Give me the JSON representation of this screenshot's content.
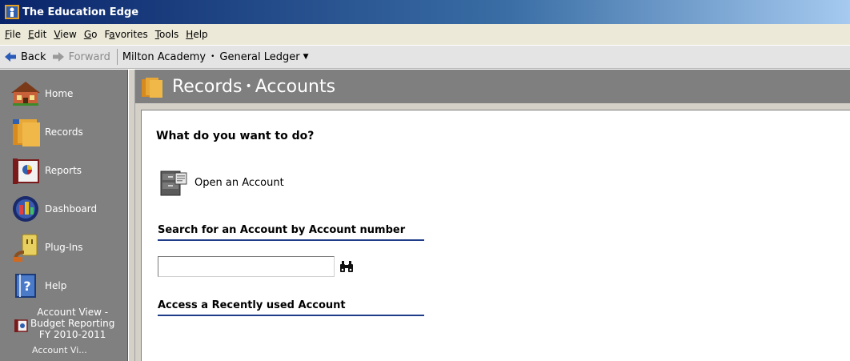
{
  "window": {
    "title": "The Education Edge"
  },
  "menu": [
    {
      "label": "File",
      "underline": "F",
      "rest": "ile"
    },
    {
      "label": "Edit",
      "underline": "E",
      "rest": "dit"
    },
    {
      "label": "View",
      "underline": "V",
      "rest": "iew"
    },
    {
      "label": "Go",
      "underline": "G",
      "rest": "o"
    },
    {
      "label": "Favorites",
      "pre": "F",
      "underline": "a",
      "rest": "vorites"
    },
    {
      "label": "Tools",
      "underline": "T",
      "rest": "ools"
    },
    {
      "label": "Help",
      "underline": "H",
      "rest": "elp"
    }
  ],
  "nav": {
    "back": "Back",
    "forward": "Forward",
    "location": "Milton Academy",
    "module": "General Ledger"
  },
  "sidebar": {
    "items": [
      {
        "label": "Home",
        "icon": "home-icon"
      },
      {
        "label": "Records",
        "icon": "records-icon"
      },
      {
        "label": "Reports",
        "icon": "reports-icon"
      },
      {
        "label": "Dashboard",
        "icon": "dashboard-icon"
      },
      {
        "label": "Plug-Ins",
        "icon": "plugins-icon"
      },
      {
        "label": "Help",
        "icon": "help-icon"
      }
    ],
    "recent": {
      "line1": "Account View -",
      "line2": "Budget Reporting",
      "line3": "FY 2010-2011",
      "partial": "Account Vi..."
    }
  },
  "header": {
    "part1": "Records",
    "part2": "Accounts"
  },
  "content": {
    "question": "What do you want to do?",
    "open_account": "Open an Account",
    "search_heading": "Search for an Account by Account number",
    "search_value": "",
    "recent_heading": "Access a Recently used Account"
  },
  "colors": {
    "titlebar_start": "#0a246a",
    "sidebar_bg": "#808080",
    "header_bg": "#7f7f7f",
    "section_rule": "#1f3c88"
  }
}
